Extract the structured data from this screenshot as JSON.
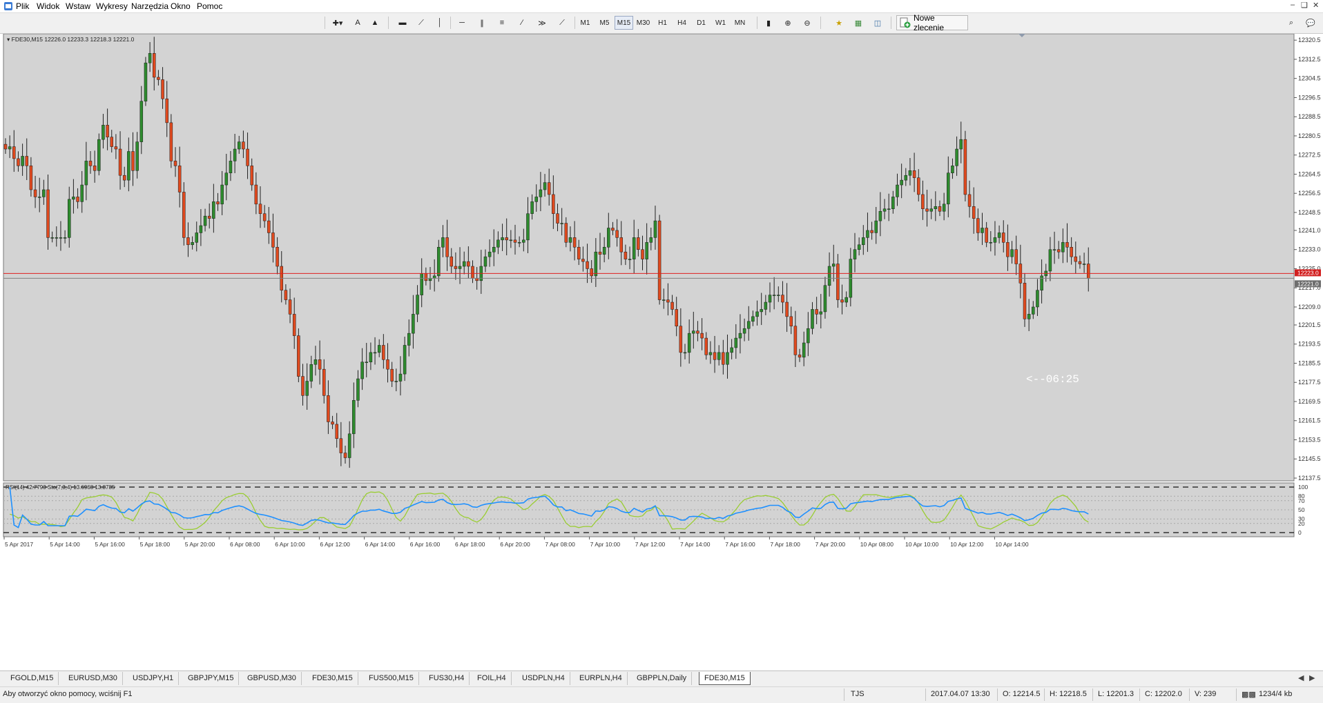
{
  "menu": {
    "items": [
      "Plik",
      "Widok",
      "Wstaw",
      "Wykresy",
      "Narzędzia",
      "Okno",
      "Pomoc"
    ]
  },
  "toolbar": {
    "text_tool_label": "A",
    "timeframes": [
      "M1",
      "M5",
      "M15",
      "M30",
      "H1",
      "H4",
      "D1",
      "W1",
      "MN"
    ],
    "selected_timeframe": "M15",
    "new_order_label": "Nowe zlecenie"
  },
  "chart": {
    "header": "FDE30,M15  12226.0 12233.3 12218.3 12221.0",
    "timer": "<--06:25",
    "bid_label": "12223.0",
    "ask_label": "12221.0",
    "indicator_header": "RSI(14) 42.7793  Sto(7,3,4) 13.6968 13.8785",
    "colors": {
      "background": "#d3d3d3",
      "bull": "#2e8b2e",
      "bear": "#e04a1f",
      "bid_line": "#e02020",
      "ask_line": "#808080",
      "rsi": "#1e90ff",
      "stoch": "#9acd32"
    },
    "price_axis": [
      "12320.5",
      "12312.5",
      "12304.5",
      "12296.5",
      "12288.5",
      "12280.5",
      "12272.5",
      "12264.5",
      "12256.5",
      "12248.5",
      "12241.0",
      "12233.0",
      "12225.0",
      "12217.0",
      "12209.0",
      "12201.5",
      "12193.5",
      "12185.5",
      "12177.5",
      "12169.5",
      "12161.5",
      "12153.5",
      "12145.5",
      "12137.5"
    ],
    "indicator_axis": [
      "100",
      "80",
      "70",
      "50",
      "30",
      "20",
      "0"
    ],
    "time_axis": [
      "5 Apr 2017",
      "5 Apr 14:00",
      "5 Apr 16:00",
      "5 Apr 18:00",
      "5 Apr 20:00",
      "6 Apr 08:00",
      "6 Apr 10:00",
      "6 Apr 12:00",
      "6 Apr 14:00",
      "6 Apr 16:00",
      "6 Apr 18:00",
      "6 Apr 20:00",
      "7 Apr 08:00",
      "7 Apr 10:00",
      "7 Apr 12:00",
      "7 Apr 14:00",
      "7 Apr 16:00",
      "7 Apr 18:00",
      "7 Apr 20:00",
      "10 Apr 08:00",
      "10 Apr 10:00",
      "10 Apr 12:00",
      "10 Apr 14:00"
    ]
  },
  "chart_data": {
    "type": "candlestick",
    "symbol": "FDE30",
    "timeframe": "M15",
    "last": {
      "open": 12226.0,
      "high": 12233.3,
      "low": 12218.3,
      "close": 12221.0
    },
    "bid": 12223.0,
    "ask": 12221.0,
    "ylim": [
      12137.5,
      12322
    ],
    "closes": [
      12275,
      12276,
      12271,
      12268,
      12272,
      12268,
      12258,
      12255,
      12255,
      12258,
      12238,
      12238,
      12238,
      12238,
      12238,
      12254,
      12255,
      12253,
      12260,
      12270,
      12268,
      12266,
      12279,
      12285,
      12280,
      12276,
      12275,
      12264,
      12262,
      12274,
      12266,
      12278,
      12295,
      12311,
      12315,
      12305,
      12304,
      12296,
      12286,
      12270,
      12268,
      12257,
      12238,
      12235,
      12236,
      12240,
      12243,
      12247,
      12246,
      12253,
      12252,
      12260,
      12265,
      12270,
      12275,
      12278,
      12275,
      12268,
      12260,
      12252,
      12248,
      12245,
      12240,
      12234,
      12226,
      12216,
      12212,
      12206,
      12197,
      12180,
      12172,
      12178,
      12185,
      12187,
      12183,
      12172,
      12161,
      12160,
      12154,
      12148,
      12146,
      12156,
      12170,
      12179,
      12186,
      12186,
      12190,
      12190,
      12193,
      12187,
      12183,
      12178,
      12178,
      12181,
      12193,
      12198,
      12206,
      12214,
      12223,
      12220,
      12221,
      12222,
      12234,
      12238,
      12230,
      12226,
      12225,
      12226,
      12228,
      12226,
      12221,
      12220,
      12226,
      12230,
      12232,
      12234,
      12237,
      12238,
      12237,
      12237,
      12236,
      12236,
      12237,
      12248,
      12253,
      12255,
      12258,
      12261,
      12256,
      12248,
      12244,
      12244,
      12236,
      12238,
      12234,
      12229,
      12228,
      12225,
      12222,
      12232,
      12231,
      12234,
      12242,
      12241,
      12238,
      12232,
      12229,
      12229,
      12238,
      12233,
      12229,
      12236,
      12238,
      12245,
      12212,
      12212,
      12211,
      12208,
      12201,
      12190,
      12190,
      12198,
      12199,
      12198,
      12196,
      12189,
      12190,
      12187,
      12190,
      12185,
      12190,
      12192,
      12196,
      12198,
      12200,
      12203,
      12205,
      12207,
      12208,
      12211,
      12214,
      12214,
      12214,
      12211,
      12205,
      12201,
      12189,
      12188,
      12194,
      12200,
      12208,
      12206,
      12207,
      12218,
      12226,
      12227,
      12212,
      12211,
      12213,
      12229,
      12233,
      12235,
      12238,
      12241,
      12240,
      12245,
      12249,
      12250,
      12250,
      12255,
      12260,
      12262,
      12264,
      12266,
      12263,
      12256,
      12250,
      12249,
      12250,
      12251,
      12249,
      12252,
      12265,
      12268,
      12275,
      12279,
      12256,
      12251,
      12246,
      12240,
      12242,
      12236,
      12236,
      12238,
      12240,
      12236,
      12230,
      12233,
      12227,
      12219,
      12204,
      12206,
      12209,
      12216,
      12222,
      12224,
      12233,
      12233,
      12232,
      12236,
      12234,
      12230,
      12228,
      12227,
      12227,
      12221
    ]
  }
}
